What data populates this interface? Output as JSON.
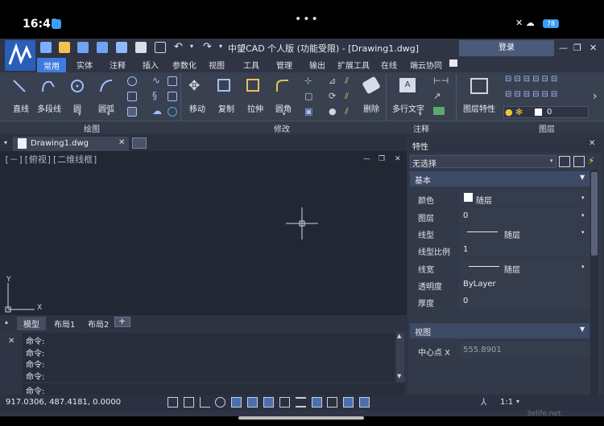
{
  "device": {
    "time": "16:41",
    "battery": "78"
  },
  "app": {
    "title": "中望CAD 个人版 (功能受限) - [Drawing1.dwg]",
    "login_label": "登录"
  },
  "ribbon_tabs": [
    "常用",
    "实体",
    "注释",
    "插入",
    "参数化",
    "视图",
    "工具",
    "管理",
    "输出",
    "扩展工具",
    "在线",
    "端云协同"
  ],
  "ribbon": {
    "draw": [
      "直线",
      "多段线",
      "圆",
      "圆弧"
    ],
    "modify": [
      "移动",
      "复制",
      "拉伸",
      "圆角",
      "删除"
    ],
    "annotate": [
      "多行文字"
    ],
    "layer": [
      "图层特性"
    ],
    "layer_value": "0",
    "groups": {
      "draw": "绘图",
      "modify": "修改",
      "annotate": "注释",
      "layer": "图层"
    }
  },
  "document": {
    "tab": "Drawing1.dwg",
    "view_label": "[－][俯视][二维线框]",
    "axis_y": "Y",
    "axis_x": "X"
  },
  "layouts": [
    "模型",
    "布局1",
    "布局2"
  ],
  "command": {
    "history": [
      "命令:",
      "命令:",
      "命令:",
      "命令:"
    ],
    "prompt": "命令:"
  },
  "status": {
    "coords": "917.0306, 487.4181, 0.0000",
    "scale": "1:1"
  },
  "properties": {
    "title": "特性",
    "selection": "无选择",
    "basic_section": "基本",
    "rows": [
      {
        "label": "颜色",
        "value": "随层"
      },
      {
        "label": "图层",
        "value": "0"
      },
      {
        "label": "线型",
        "value": "随层"
      },
      {
        "label": "线型比例",
        "value": "1"
      },
      {
        "label": "线宽",
        "value": "随层"
      },
      {
        "label": "透明度",
        "value": "ByLayer"
      },
      {
        "label": "厚度",
        "value": "0"
      }
    ],
    "view_section": "视图",
    "view_rows": [
      {
        "label": "中心点 X",
        "value": "555.8901"
      }
    ]
  },
  "colors": {
    "accent": "#3e7bdf",
    "panel": "#2f3544",
    "canvas": "#212733"
  },
  "watermark": "3elife.net"
}
